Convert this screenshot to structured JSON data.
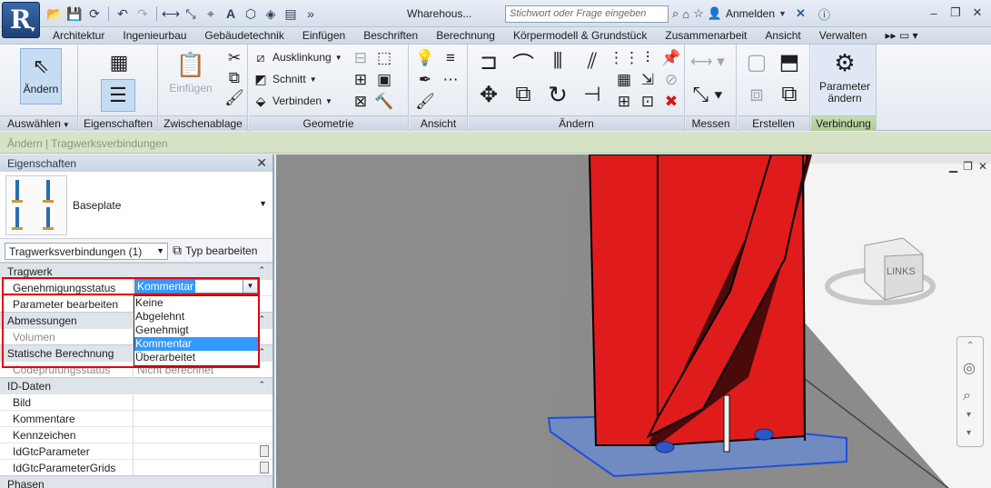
{
  "titlebar": {
    "app_letter": "R",
    "doc_title": "Wharehous...",
    "search_placeholder": "Stichwort oder Frage eingeben",
    "sign_in": "Anmelden"
  },
  "tabs": [
    "Architektur",
    "Ingenieurbau",
    "Gebäudetechnik",
    "Einfügen",
    "Beschriften",
    "Berechnung",
    "Körpermodell & Grundstück",
    "Zusammenarbeit",
    "Ansicht",
    "Verwalten"
  ],
  "ribbon": {
    "modify_label": "Ändern",
    "paste_label": "Einfügen",
    "cope_label": "Ausklinkung",
    "cut_label": "Schnitt",
    "join_label": "Verbinden",
    "param_label_1": "Parameter",
    "param_label_2": "ändern",
    "panels": {
      "select": "Auswählen",
      "properties": "Eigenschaften",
      "clipboard": "Zwischenablage",
      "geometry": "Geometrie",
      "view": "Ansicht",
      "modify": "Ändern",
      "measure": "Messen",
      "create": "Erstellen",
      "connection": "Verbindung"
    }
  },
  "context_bar": "Ändern | Tragwerksverbindungen",
  "properties": {
    "title": "Eigenschaften",
    "type_name": "Baseplate",
    "filter": "Tragwerksverbindungen (1)",
    "edit_type": "Typ bearbeiten",
    "groups": {
      "tragwerk": "Tragwerk",
      "abmessungen": "Abmessungen",
      "statik": "Statische Berechnung",
      "id_daten": "ID-Daten",
      "phasen": "Phasen"
    },
    "rows": {
      "genehmigung": "Genehmigungsstatus",
      "parameter": "Parameter bearbeiten",
      "volumen": "Volumen",
      "codepruefung": "Codeprüfungsstatus",
      "codepruefung_value": "Nicht berechnet",
      "bild": "Bild",
      "kommentare": "Kommentare",
      "kennzeichen": "Kennzeichen",
      "idgtc": "IdGtcParameter",
      "idgtcgrids": "IdGtcParameterGrids"
    },
    "dropdown": {
      "current": "Kommentar",
      "options": [
        "Keine",
        "Abgelehnt",
        "Genehmigt",
        "Kommentar",
        "Überarbeitet"
      ]
    }
  },
  "viewcube_label": "LINKS",
  "colors": {
    "highlight": "#3399ff",
    "annotation_red": "#e3000f",
    "steel_red": "#e01b1b",
    "plate_blue": "#3f6ff0"
  }
}
